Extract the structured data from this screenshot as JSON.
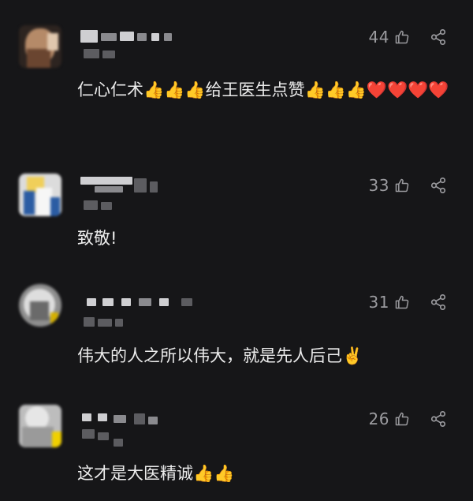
{
  "colors": {
    "background": "#161618",
    "text": "#ececec",
    "meta": "#9b9b9f",
    "heart": "#e8443a",
    "thumb": "#f1b54a"
  },
  "comments": [
    {
      "likes": "44",
      "text": "仁心仁术👍👍👍给王医生点赞👍👍👍❤️❤️❤️❤️",
      "avatar_colors": [
        "#3a2c24",
        "#b98e6d",
        "#6d4630",
        "#e2cbb2"
      ]
    },
    {
      "likes": "33",
      "text": "致敬!",
      "avatar_colors": [
        "#d9d9d9",
        "#2a5aa0",
        "#f0d060",
        "#ffffff"
      ]
    },
    {
      "likes": "31",
      "text": "伟大的人之所以伟大，就是先人后己✌️",
      "avatar_colors": [
        "#b8b8b8",
        "#e0e0e0",
        "#6b6b6b",
        "#d4b000"
      ]
    },
    {
      "likes": "26",
      "text": "这才是大医精诚👍👍",
      "avatar_colors": [
        "#c7c7c7",
        "#9c9c9c",
        "#e4e4e4",
        "#f0d000"
      ]
    }
  ],
  "icons": {
    "like": "thumb-up-outline-icon",
    "share": "share-icon"
  }
}
